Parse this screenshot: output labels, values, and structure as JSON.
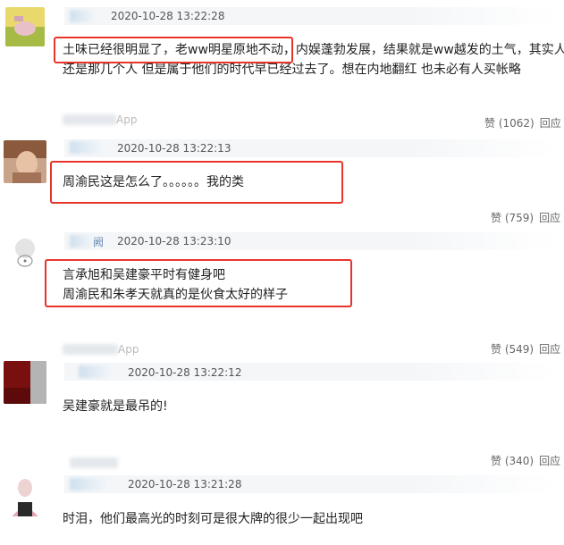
{
  "comments": [
    {
      "timestamp": "2020-10-28 13:22:28",
      "text_highlight": "土味已经很明显了，老ww明星原地不动，",
      "text_rest": "内娱蓬勃发展，结果就是ww越发的土气，其实人",
      "text_line2": "还是那几个人 但是属于他们的时代早已经过去了。想在内地翻红 也未必有人买帐略",
      "source_suffix": "App",
      "like_label": "赞 (1062)",
      "reply_label": "回应"
    },
    {
      "timestamp": "2020-10-28 13:22:13",
      "text": "周渝民这是怎么了。。。。。。我的类",
      "like_label": "赞 (759)",
      "reply_label": "回应"
    },
    {
      "timestamp": "2020-10-28 13:23:10",
      "name_suffix": "阙",
      "text_line1": "言承旭和吴建豪平时有健身吧",
      "text_line2": "周渝民和朱孝天就真的是伙食太好的样子",
      "source_suffix": "App",
      "like_label": "赞 (549)",
      "reply_label": "回应"
    },
    {
      "timestamp": "2020-10-28 13:22:12",
      "text": "吴建豪就是最吊的!",
      "like_label": "赞 (340)",
      "reply_label": "回应"
    },
    {
      "timestamp": "2020-10-28 13:21:28",
      "text": "时泪，他们最高光的时刻可是很大牌的很少一起出现吧"
    }
  ],
  "colors": {
    "highlight_border": "#e8352b",
    "meta_background": "#f4f6f8"
  }
}
